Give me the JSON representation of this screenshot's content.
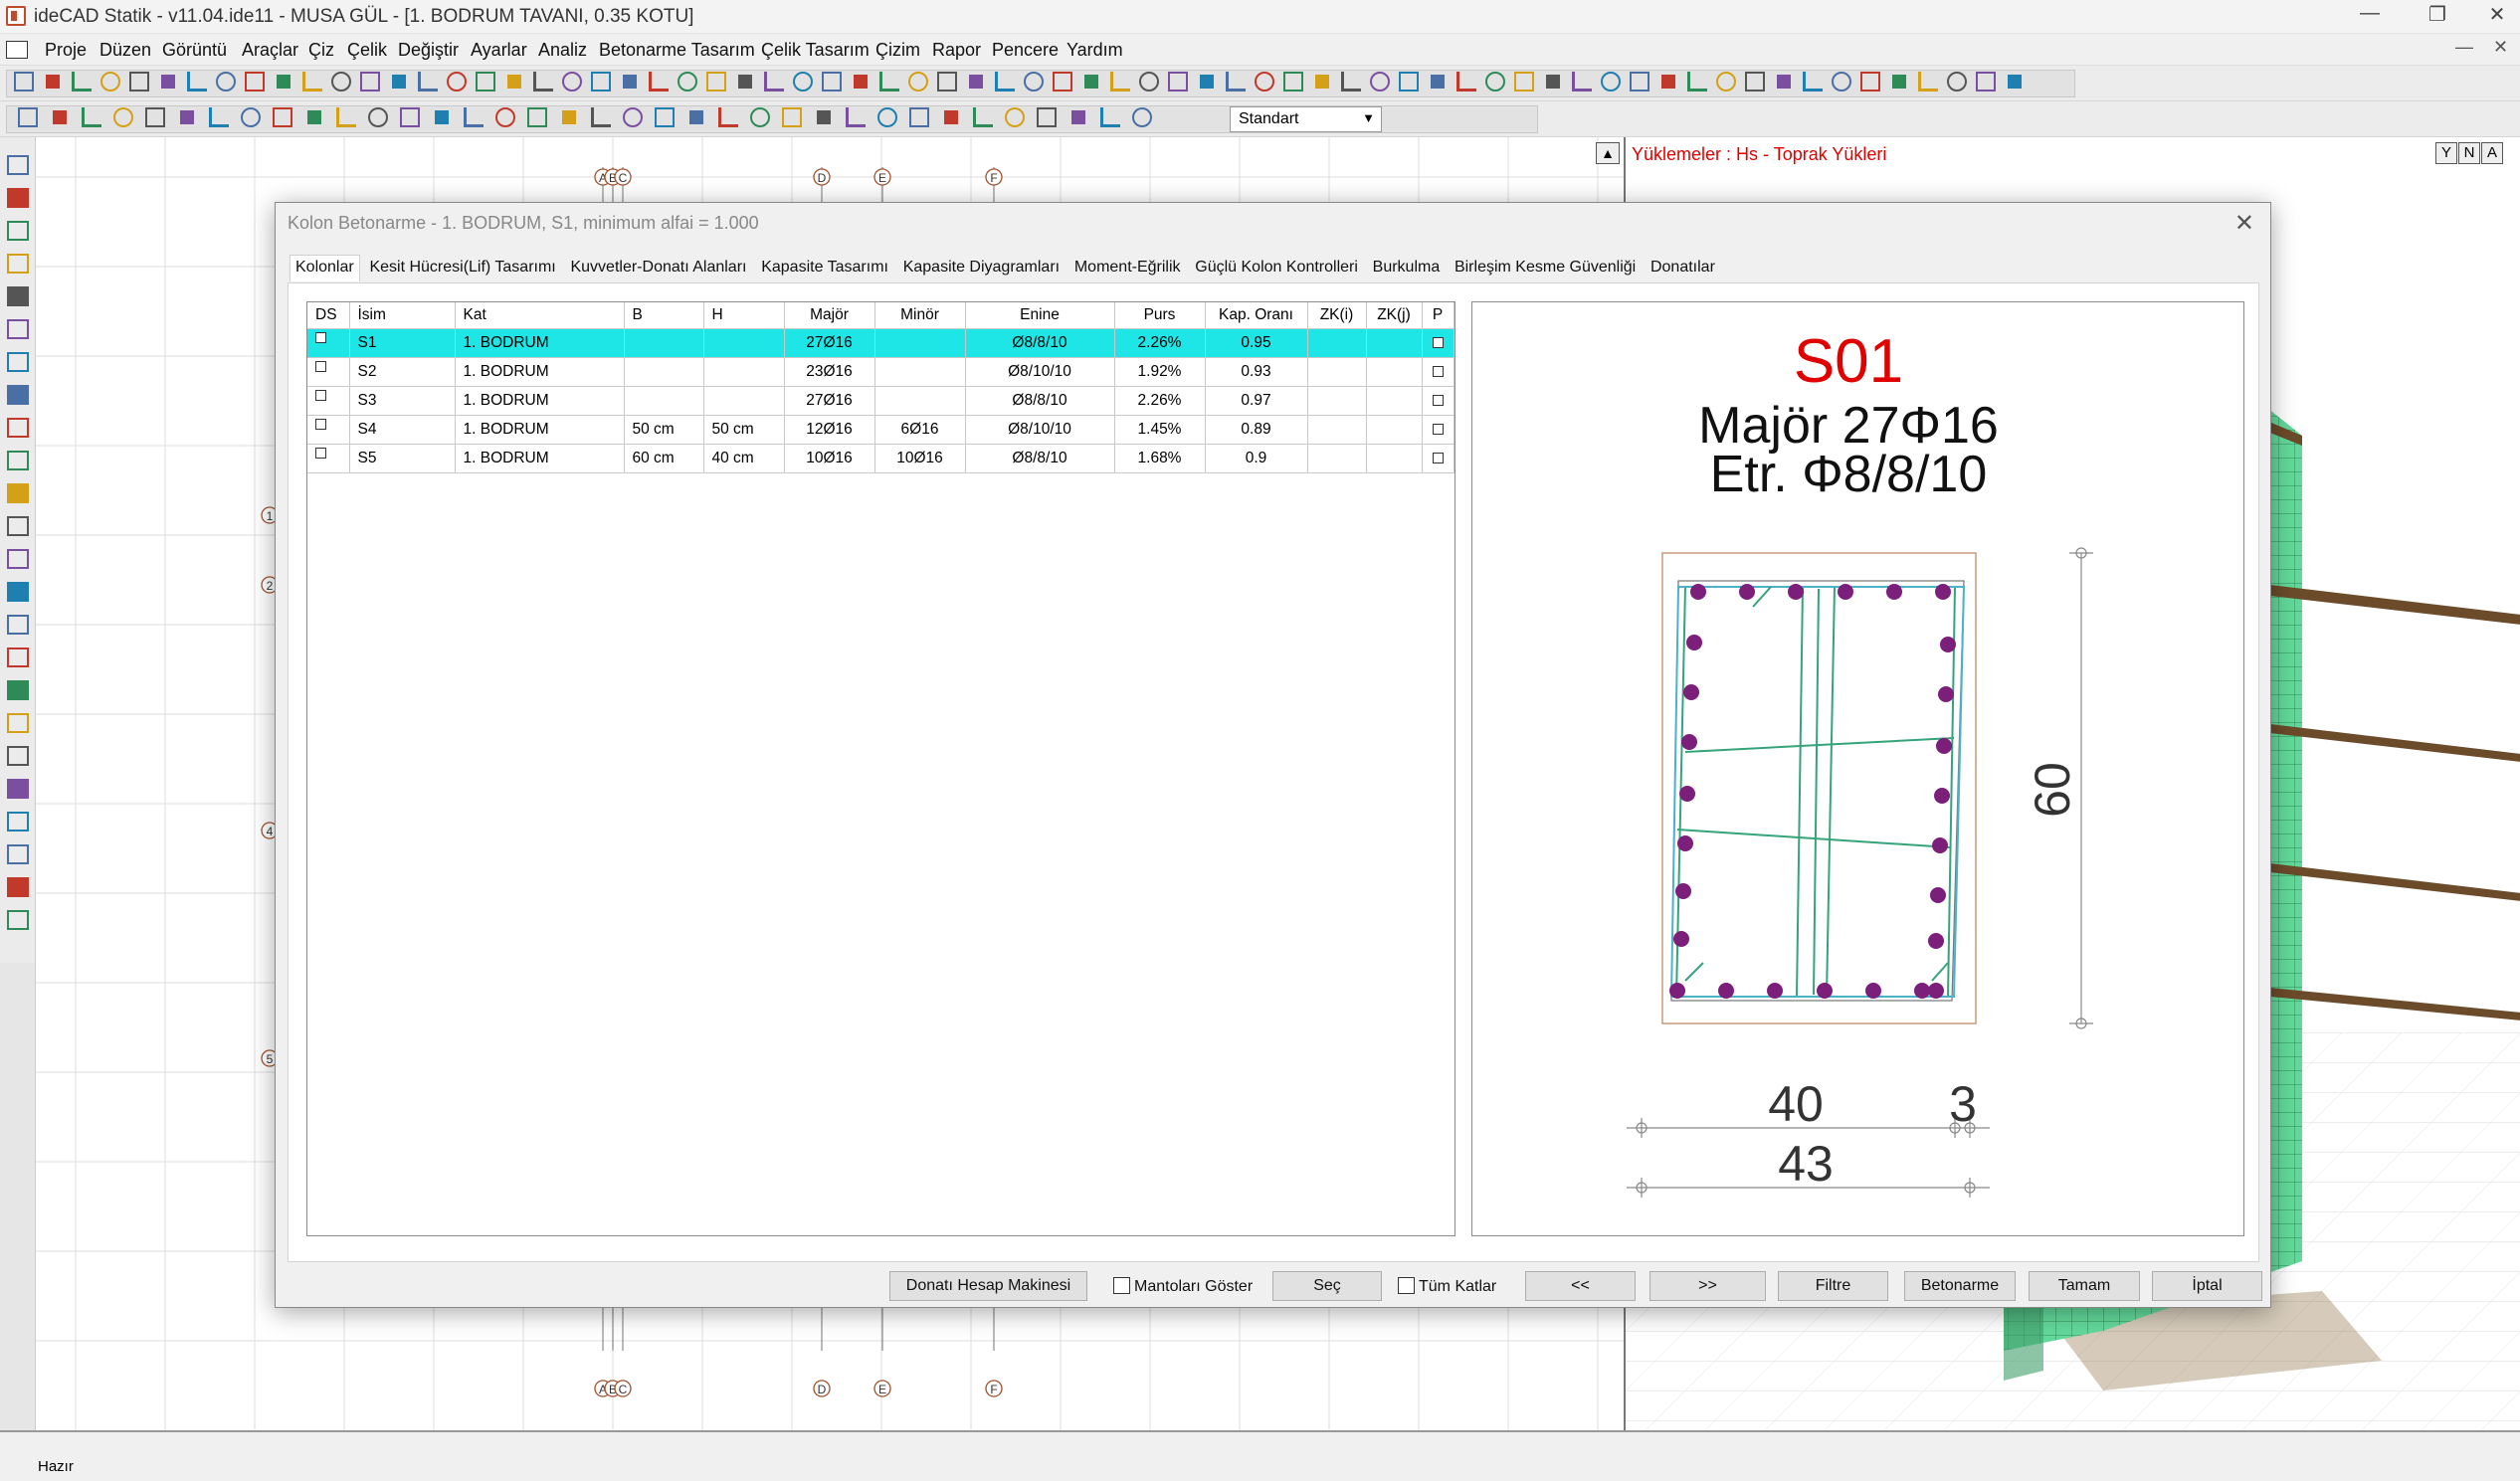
{
  "window": {
    "title": "ideCAD Statik - v11.04.ide11 - MUSA GÜL - [1. BODRUM TAVANI,  0.35 KOTU]",
    "minimize": "—",
    "maximize": "❐",
    "close": "✕"
  },
  "menu": [
    "Proje",
    "Düzen",
    "Görüntü",
    "Araçlar",
    "Çiz",
    "Çelik",
    "Değiştir",
    "Ayarlar",
    "Analiz",
    "Betonarme Tasarım",
    "Çelik Tasarım",
    "Çizim",
    "Rapor",
    "Pencere",
    "Yardım"
  ],
  "toolbar": {
    "style_select": "Standart"
  },
  "plan": {
    "axis_top": [
      "A",
      "B",
      "C",
      "D",
      "E",
      "F"
    ],
    "axis_left": [
      "1",
      "2",
      "4",
      "5"
    ]
  },
  "view3d": {
    "load_label": "Yüklemeler : Hs - Toprak Yükleri",
    "view_buttons": [
      "Y",
      "N",
      "A"
    ]
  },
  "status": {
    "text": "Hazır"
  },
  "dialog": {
    "title": "Kolon Betonarme - 1. BODRUM, S1, minimum alfai = 1.000",
    "tabs": [
      "Kolonlar",
      "Kesit Hücresi(Lif) Tasarımı",
      "Kuvvetler-Donatı Alanları",
      "Kapasite Tasarımı",
      "Kapasite Diyagramları",
      "Moment-Eğrilik",
      "Güçlü Kolon Kontrolleri",
      "Burkulma",
      "Birleşim Kesme Güvenliği",
      "Donatılar"
    ],
    "columns": [
      "DS",
      "İsim",
      "Kat",
      "B",
      "H",
      "Majör",
      "Minör",
      "Enine",
      "Purs",
      "Kap. Oranı",
      "ZK(i)",
      "ZK(j)",
      "P"
    ],
    "rows": [
      {
        "name": "S1",
        "kat": "1. BODRUM",
        "b": "",
        "h": "",
        "major": "27Ø16",
        "minor": "",
        "enine": "Ø8/8/10",
        "purs": "2.26%",
        "kap": "0.95",
        "zki": "",
        "zkj": ""
      },
      {
        "name": "S2",
        "kat": "1. BODRUM",
        "b": "",
        "h": "",
        "major": "23Ø16",
        "minor": "",
        "enine": "Ø8/10/10",
        "purs": "1.92%",
        "kap": "0.93",
        "zki": "",
        "zkj": ""
      },
      {
        "name": "S3",
        "kat": "1. BODRUM",
        "b": "",
        "h": "",
        "major": "27Ø16",
        "minor": "",
        "enine": "Ø8/8/10",
        "purs": "2.26%",
        "kap": "0.97",
        "zki": "",
        "zkj": ""
      },
      {
        "name": "S4",
        "kat": "1. BODRUM",
        "b": "50 cm",
        "h": "50 cm",
        "major": "12Ø16",
        "minor": "6Ø16",
        "enine": "Ø8/10/10",
        "purs": "1.45%",
        "kap": "0.89",
        "zki": "",
        "zkj": ""
      },
      {
        "name": "S5",
        "kat": "1. BODRUM",
        "b": "60 cm",
        "h": "40 cm",
        "major": "10Ø16",
        "minor": "10Ø16",
        "enine": "Ø8/8/10",
        "purs": "1.68%",
        "kap": "0.9",
        "zki": "",
        "zkj": ""
      }
    ],
    "section": {
      "name": "S01",
      "major_text": "Majör 27Φ16",
      "stirrup_text": "Etr. Φ8/8/10",
      "dim_height": "60",
      "dim_width": "40",
      "dim_cover": "3",
      "dim_total": "43"
    },
    "buttons": {
      "calculator": "Donatı Hesap Makinesi",
      "show_jackets": "Mantoları Göster",
      "select": "Seç",
      "all_floors": "Tüm Katlar",
      "prev": "<<",
      "next": ">>",
      "filter": "Filtre",
      "concrete": "Betonarme",
      "ok": "Tamam",
      "cancel": "İptal"
    }
  },
  "colors": {
    "selected_row": "#1ee6e6",
    "section_title": "#e00000",
    "rebar": "#7b1f7a",
    "stirrup": "#35a47a",
    "mesh_green": "#62d99a"
  }
}
